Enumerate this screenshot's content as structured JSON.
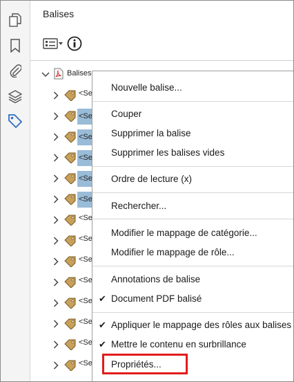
{
  "panel": {
    "title": "Balises"
  },
  "tree": {
    "root_label": "Balises",
    "children": [
      {
        "label": "<Se",
        "selected": false
      },
      {
        "label": "<Se",
        "selected": true
      },
      {
        "label": "<Se",
        "selected": true
      },
      {
        "label": "<Se",
        "selected": true
      },
      {
        "label": "<Se",
        "selected": true
      },
      {
        "label": "<Se",
        "selected": true
      },
      {
        "label": "<Se",
        "selected": false
      },
      {
        "label": "<Se",
        "selected": false
      },
      {
        "label": "<Se",
        "selected": false
      },
      {
        "label": "<Se",
        "selected": false
      },
      {
        "label": "<Se",
        "selected": false
      },
      {
        "label": "<Se",
        "selected": false
      },
      {
        "label": "<Se",
        "selected": false
      },
      {
        "label": "<Se",
        "selected": false
      }
    ]
  },
  "context_menu": {
    "new_tag": "Nouvelle balise...",
    "cut": "Couper",
    "delete_tag": "Supprimer la balise",
    "delete_empty_tags": "Supprimer les balises vides",
    "reading_order": "Ordre de lecture (x)",
    "find": "Rechercher...",
    "edit_class_map": "Modifier le mappage de catégorie...",
    "edit_role_map": "Modifier le mappage de rôle...",
    "tag_annotations": "Annotations de balise",
    "tagged_pdf": "Document PDF balisé",
    "apply_role_map": "Appliquer le mappage des rôles aux balises",
    "highlight_content": "Mettre le contenu en surbrillance",
    "properties": "Propriétés..."
  },
  "colors": {
    "selection": "#99bcd8",
    "accent_blue": "#2d6fc2",
    "highlight_box": "#e21b1b",
    "tag_icon": "#c7a05a"
  }
}
